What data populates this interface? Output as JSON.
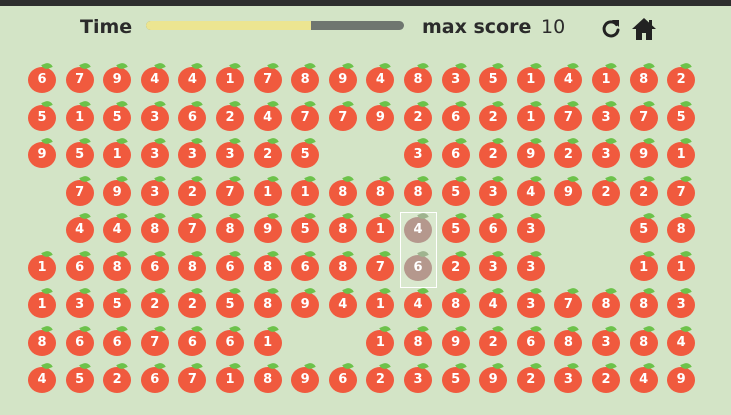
{
  "hud": {
    "time_label": "Time",
    "time_remaining_fraction": 0.64,
    "max_score_label": "max score",
    "max_score": "10",
    "restart_icon": "restart-icon",
    "home_icon": "home-icon"
  },
  "colors": {
    "background": "#d3e4c6",
    "apple": "#f05a3e",
    "leaf": "#6cc24a",
    "timebar_fill": "#ece591",
    "timebar_track": "#6f7670"
  },
  "board": {
    "rows": [
      [
        "6",
        "7",
        "9",
        "4",
        "4",
        "1",
        "7",
        "8",
        "9",
        "4",
        "8",
        "3",
        "5",
        "1",
        "4",
        "1",
        "8",
        "2"
      ],
      [
        "5",
        "1",
        "5",
        "3",
        "6",
        "2",
        "4",
        "7",
        "7",
        "9",
        "2",
        "6",
        "2",
        "1",
        "7",
        "3",
        "7",
        "5"
      ],
      [
        "9",
        "5",
        "1",
        "3",
        "3",
        "3",
        "2",
        "5",
        "",
        "",
        "3",
        "6",
        "2",
        "9",
        "2",
        "3",
        "9",
        "1"
      ],
      [
        "",
        "7",
        "9",
        "3",
        "2",
        "7",
        "1",
        "1",
        "8",
        "8",
        "8",
        "5",
        "3",
        "4",
        "9",
        "2",
        "2",
        "7"
      ],
      [
        "",
        "4",
        "4",
        "8",
        "7",
        "8",
        "9",
        "5",
        "8",
        "1",
        "4",
        "5",
        "6",
        "3",
        "",
        "",
        "5",
        "8"
      ],
      [
        "1",
        "6",
        "8",
        "6",
        "8",
        "6",
        "8",
        "6",
        "8",
        "7",
        "6",
        "2",
        "3",
        "3",
        "",
        "",
        "1",
        "1"
      ],
      [
        "1",
        "3",
        "5",
        "2",
        "2",
        "5",
        "8",
        "9",
        "4",
        "1",
        "4",
        "8",
        "4",
        "3",
        "7",
        "8",
        "8",
        "3"
      ],
      [
        "8",
        "6",
        "6",
        "7",
        "6",
        "6",
        "1",
        "",
        "",
        "1",
        "8",
        "9",
        "2",
        "6",
        "8",
        "3",
        "8",
        "4"
      ],
      [
        "4",
        "5",
        "2",
        "6",
        "7",
        "1",
        "8",
        "9",
        "6",
        "2",
        "3",
        "5",
        "9",
        "2",
        "3",
        "2",
        "4",
        "9"
      ]
    ],
    "selected": [
      [
        4,
        10
      ],
      [
        5,
        10
      ]
    ]
  }
}
